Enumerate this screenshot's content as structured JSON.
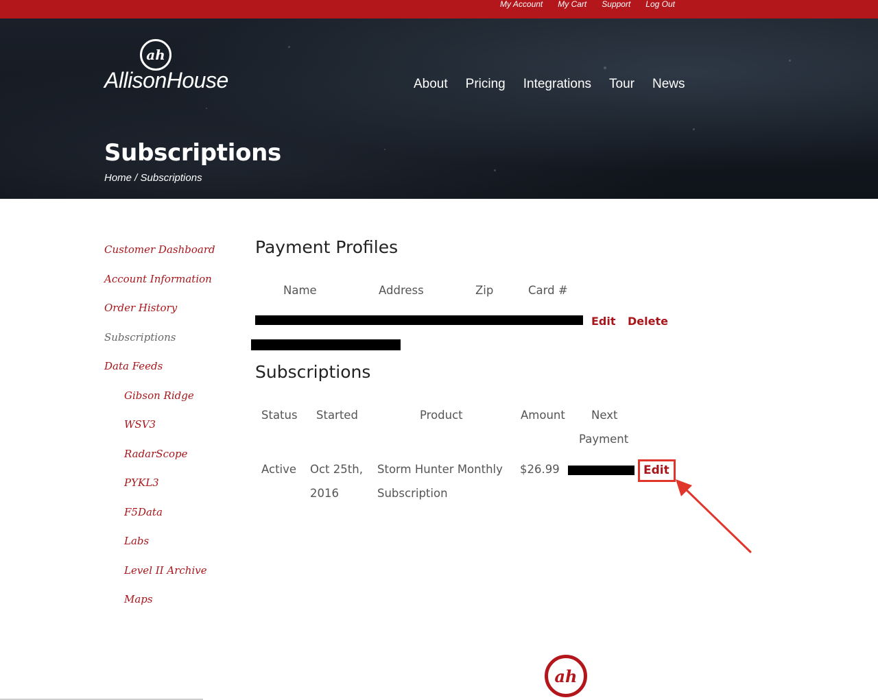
{
  "topbar": {
    "links": [
      "My Account",
      "My Cart",
      "Support",
      "Log Out"
    ]
  },
  "brand": {
    "name": "AllisonHouse",
    "mark": "ah"
  },
  "nav": {
    "items": [
      "About",
      "Pricing",
      "Integrations",
      "Tour",
      "News"
    ]
  },
  "header": {
    "title": "Subscriptions",
    "breadcrumb_home": "Home",
    "breadcrumb_sep": " / ",
    "breadcrumb_current": "Subscriptions"
  },
  "sidebar": {
    "items": [
      {
        "label": "Customer Dashboard"
      },
      {
        "label": "Account Information"
      },
      {
        "label": "Order History"
      },
      {
        "label": "Subscriptions"
      },
      {
        "label": "Data Feeds"
      },
      {
        "label": "Gibson Ridge"
      },
      {
        "label": "WSV3"
      },
      {
        "label": "RadarScope"
      },
      {
        "label": "PYKL3"
      },
      {
        "label": "F5Data"
      },
      {
        "label": "Labs"
      },
      {
        "label": "Level II Archive"
      },
      {
        "label": "Maps"
      }
    ]
  },
  "payment_profiles": {
    "title": "Payment Profiles",
    "columns": [
      "Name",
      "Address",
      "Zip",
      "Card #"
    ],
    "actions": {
      "edit": "Edit",
      "delete": "Delete"
    }
  },
  "subscriptions": {
    "title": "Subscriptions",
    "columns": [
      "Status",
      "Started",
      "Product",
      "Amount",
      "Next",
      "Payment"
    ],
    "row": {
      "status": "Active",
      "started_1": "Oct 25th,",
      "started_2": "2016",
      "product_1": "Storm Hunter Monthly",
      "product_2": "Subscription",
      "amount": "$26.99",
      "edit": "Edit"
    }
  },
  "colors": {
    "brand_red": "#b3171c",
    "link_red": "#a8161b",
    "highlight": "#e0352b"
  }
}
